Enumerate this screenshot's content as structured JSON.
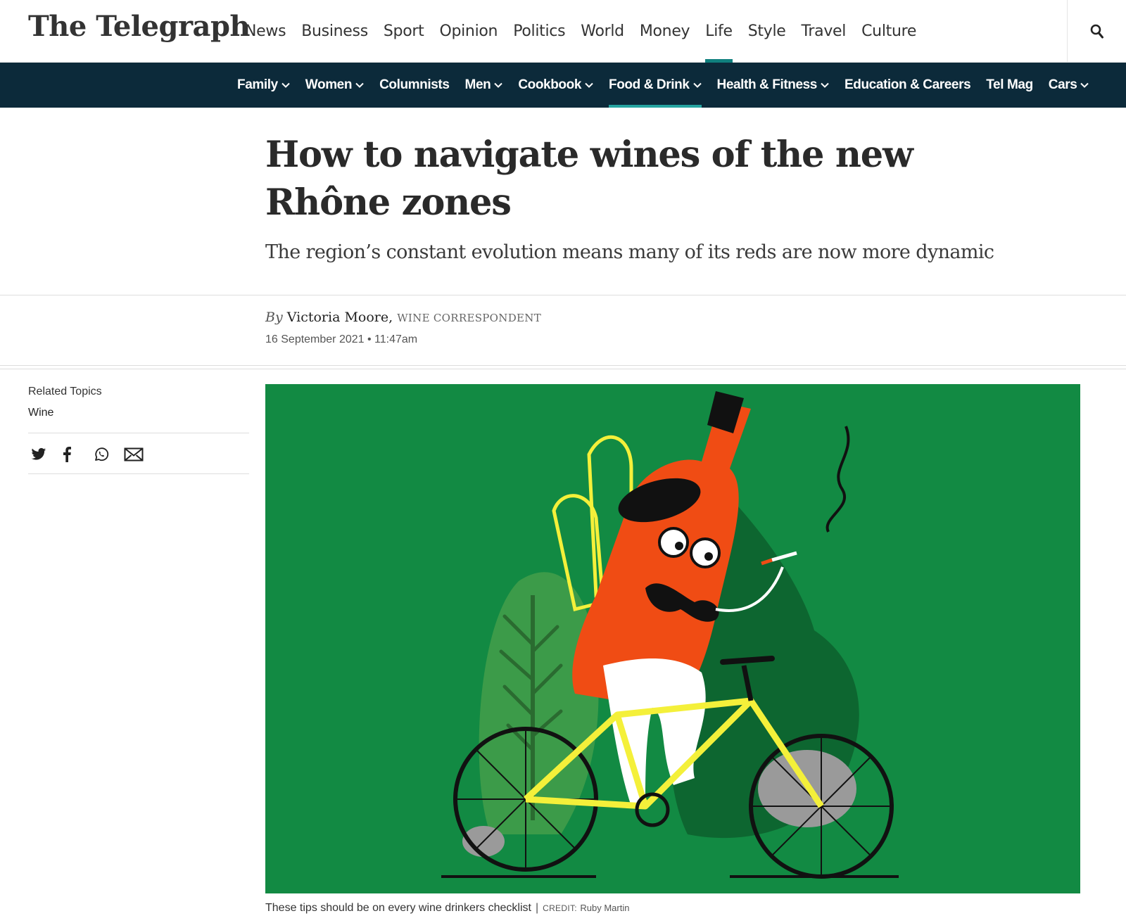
{
  "brand": {
    "logo": "The Telegraph"
  },
  "primary_nav": [
    {
      "label": "News"
    },
    {
      "label": "Business"
    },
    {
      "label": "Sport"
    },
    {
      "label": "Opinion"
    },
    {
      "label": "Politics"
    },
    {
      "label": "World"
    },
    {
      "label": "Money"
    },
    {
      "label": "Life",
      "active": true
    },
    {
      "label": "Style"
    },
    {
      "label": "Travel"
    },
    {
      "label": "Culture"
    }
  ],
  "search": {
    "icon": "search-icon"
  },
  "sub_nav": [
    {
      "label": "Family",
      "has_dropdown": true
    },
    {
      "label": "Women",
      "has_dropdown": true
    },
    {
      "label": "Columnists",
      "has_dropdown": false
    },
    {
      "label": "Men",
      "has_dropdown": true
    },
    {
      "label": "Cookbook",
      "has_dropdown": true
    },
    {
      "label": "Food & Drink",
      "has_dropdown": true,
      "active": true
    },
    {
      "label": "Health & Fitness",
      "has_dropdown": true
    },
    {
      "label": "Education & Careers",
      "has_dropdown": false
    },
    {
      "label": "Tel Mag",
      "has_dropdown": false
    },
    {
      "label": "Cars",
      "has_dropdown": true
    }
  ],
  "article": {
    "headline": "How to navigate wines of the new Rhône zones",
    "standfirst": "The region’s constant evolution means many of its reds are now more dynamic",
    "byline_prefix": "By",
    "author": "Victoria Moore,",
    "author_role": "WINE CORRESPONDENT",
    "date": "16 September 2021 • 11:47am"
  },
  "sidebar": {
    "related_label": "Related Topics",
    "related_topics": [
      "Wine"
    ],
    "share_icons": [
      "twitter-icon",
      "facebook-icon",
      "whatsapp-icon",
      "email-icon"
    ]
  },
  "image": {
    "caption": "These tips should be on every wine drinkers checklist",
    "credit_label": "CREDIT:",
    "credit": "Ruby Martin",
    "background_color": "#128a43"
  },
  "colors": {
    "subnav_bg": "#0c2a3a",
    "accent": "#10807e"
  }
}
